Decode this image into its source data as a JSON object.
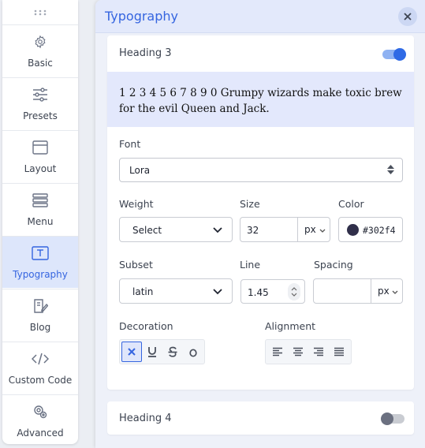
{
  "sidebar": {
    "items": [
      {
        "label": "Basic",
        "icon": "gear-icon"
      },
      {
        "label": "Presets",
        "icon": "sliders-icon"
      },
      {
        "label": "Layout",
        "icon": "layout-icon"
      },
      {
        "label": "Menu",
        "icon": "menu-icon"
      },
      {
        "label": "Typography",
        "icon": "typography-icon",
        "active": true
      },
      {
        "label": "Blog",
        "icon": "blog-icon"
      },
      {
        "label": "Custom Code",
        "icon": "code-icon"
      },
      {
        "label": "Advanced",
        "icon": "advanced-icon"
      }
    ]
  },
  "panel": {
    "title": "Typography",
    "heading3": {
      "title": "Heading 3",
      "enabled": true,
      "preview_text": "1 2 3 4 5 6 7 8 9 0 Grumpy wizards make toxic brew for the evil Queen and Jack.",
      "font": {
        "label": "Font",
        "value": "Lora"
      },
      "weight": {
        "label": "Weight",
        "value": "Select"
      },
      "size": {
        "label": "Size",
        "value": "32",
        "unit": "px"
      },
      "color": {
        "label": "Color",
        "value": "#302f4",
        "swatch": "#302f4a"
      },
      "subset": {
        "label": "Subset",
        "value": "latin"
      },
      "line": {
        "label": "Line",
        "value": "1.45"
      },
      "spacing": {
        "label": "Spacing",
        "value": "",
        "unit": "px"
      },
      "decoration": {
        "label": "Decoration",
        "options": [
          "none",
          "underline",
          "strikethrough",
          "overline"
        ],
        "selected": "none"
      },
      "alignment": {
        "label": "Alignment",
        "options": [
          "left",
          "center",
          "right",
          "justify"
        ]
      }
    },
    "heading4": {
      "title": "Heading 4",
      "enabled": false
    }
  },
  "colors": {
    "accent": "#3565e0",
    "active_bg": "#dde6fb",
    "preview_bg": "#e3e8fc"
  }
}
